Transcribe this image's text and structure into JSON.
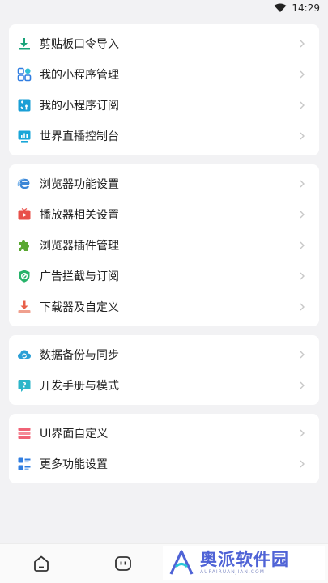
{
  "status_bar": {
    "time": "14:29"
  },
  "cards": [
    {
      "items": [
        {
          "label": "剪贴板口令导入",
          "icon": "clipboard-import-icon",
          "color": "#1aa37a"
        },
        {
          "label": "我的小程序管理",
          "icon": "grid-apps-icon",
          "color": "#2f7de1"
        },
        {
          "label": "我的小程序订阅",
          "icon": "subscription-icon",
          "color": "#1a9fd6"
        },
        {
          "label": "世界直播控制台",
          "icon": "monitor-chart-icon",
          "color": "#19a6d8"
        }
      ]
    },
    {
      "items": [
        {
          "label": "浏览器功能设置",
          "icon": "browser-e-icon",
          "color": "#3c86d6"
        },
        {
          "label": "播放器相关设置",
          "icon": "video-player-icon",
          "color": "#e8504a"
        },
        {
          "label": "浏览器插件管理",
          "icon": "puzzle-plugin-icon",
          "color": "#5aa832"
        },
        {
          "label": "广告拦截与订阅",
          "icon": "shield-block-icon",
          "color": "#27b36a"
        },
        {
          "label": "下载器及自定义",
          "icon": "download-icon",
          "color": "#e8604a"
        }
      ]
    },
    {
      "items": [
        {
          "label": "数据备份与同步",
          "icon": "cloud-sync-icon",
          "color": "#2a9fd6"
        },
        {
          "label": "开发手册与模式",
          "icon": "help-question-icon",
          "color": "#2cb6c9"
        }
      ]
    },
    {
      "items": [
        {
          "label": "UI界面自定义",
          "icon": "ui-layers-icon",
          "color": "#f06276"
        },
        {
          "label": "更多功能设置",
          "icon": "more-settings-icon",
          "color": "#2f7de1"
        }
      ]
    }
  ],
  "tab_bar": [
    {
      "icon": "home-icon"
    },
    {
      "icon": "chat-bubble-icon"
    }
  ],
  "watermark": {
    "title": "奥派软件园",
    "subtitle": "AUPAIRUANJIAN.COM"
  }
}
